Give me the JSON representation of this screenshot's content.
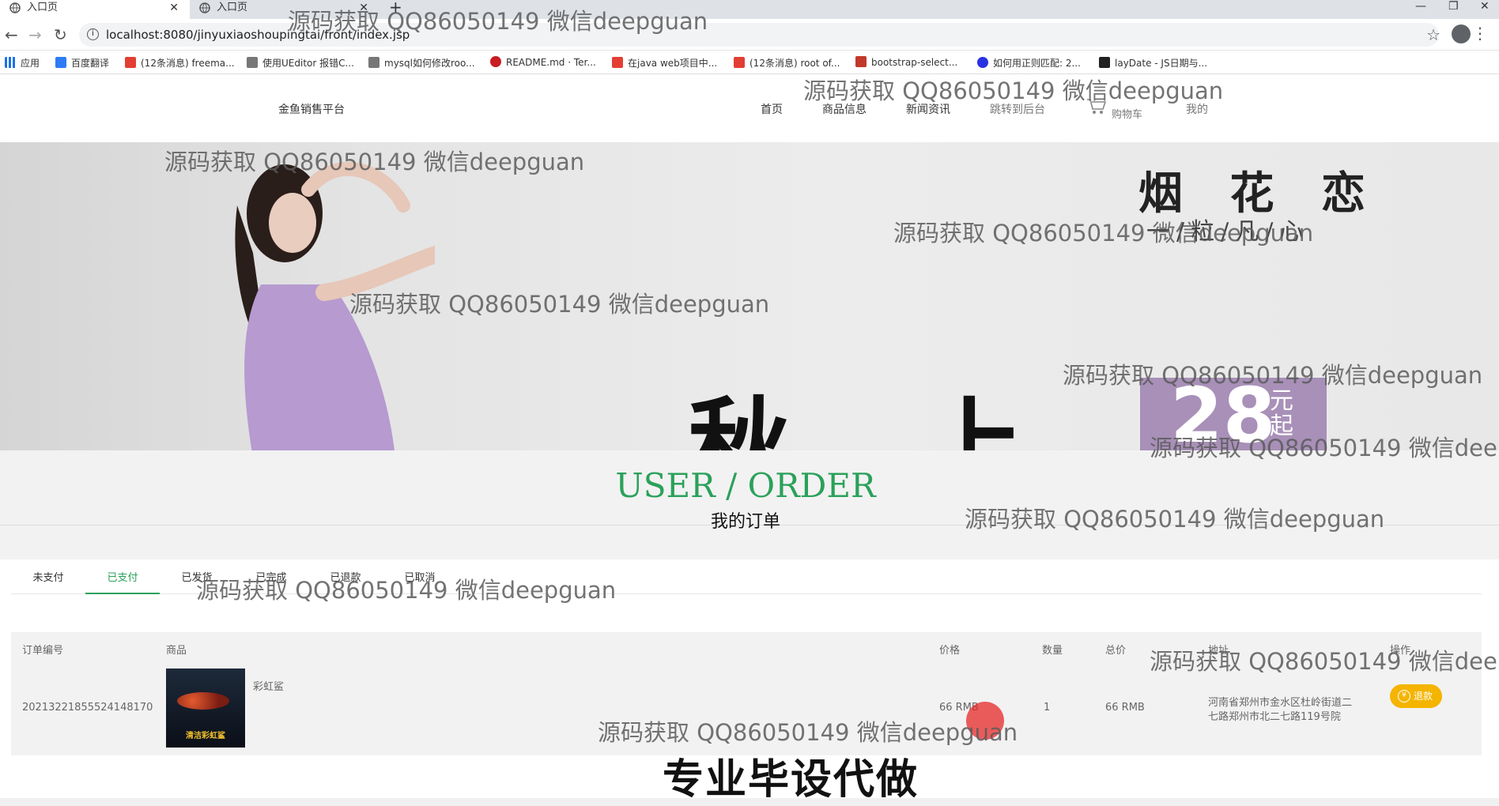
{
  "browser": {
    "tabs": [
      {
        "title": "入口页"
      },
      {
        "title": "入口页"
      }
    ],
    "new_tab": "+",
    "url": "localhost:8080/jinyuxiaoshoupingtai/front/index.jsp",
    "bookmarks": [
      {
        "label": "应用",
        "icon": "apps-grid-icon",
        "color": "#1a73e8"
      },
      {
        "label": "百度翻译",
        "icon": "baidu-translate-icon",
        "color": "#2d7cf6"
      },
      {
        "label": "(12条消息) freema...",
        "icon": "csdn-icon",
        "color": "#e33e33"
      },
      {
        "label": "使用UEditor 报错C...",
        "icon": "blog-icon",
        "color": "#444444"
      },
      {
        "label": "mysql如何修改roo...",
        "icon": "blog-icon",
        "color": "#444444"
      },
      {
        "label": "README.md · Ter...",
        "icon": "gitee-icon",
        "color": "#c71d23"
      },
      {
        "label": "在java web项目中...",
        "icon": "csdn-icon",
        "color": "#e33e33"
      },
      {
        "label": "(12条消息) root of...",
        "icon": "csdn-icon",
        "color": "#e33e33"
      },
      {
        "label": "bootstrap-select...",
        "icon": "bookmark-red-icon",
        "color": "#c0392b"
      },
      {
        "label": "如何用正则匹配: 2...",
        "icon": "baidu-paw-icon",
        "color": "#2932e1"
      },
      {
        "label": "layDate - JS日期与...",
        "icon": "layui-icon",
        "color": "#222222"
      }
    ]
  },
  "site": {
    "logo": "金鱼销售平台",
    "nav": {
      "home": "首页",
      "products": "商品信息",
      "news": "新闻资讯",
      "admin": "跳转到后台",
      "cart": "购物车",
      "mine": "我的"
    }
  },
  "banner": {
    "headline": "秋 上 新",
    "price": "28",
    "price_unit": "元起",
    "script": "烟 花 恋",
    "subtitle": "一/粒/凡/心"
  },
  "section": {
    "title_en": "USER / ORDER",
    "title_zh": "我的订单"
  },
  "order_tabs": [
    "未支付",
    "已支付",
    "已发货",
    "已完成",
    "已退款",
    "已取消"
  ],
  "active_tab": "已支付",
  "table": {
    "headers": {
      "order_no": "订单编号",
      "product": "商品",
      "price": "价格",
      "qty": "数量",
      "total": "总价",
      "address": "地址",
      "action": "操作"
    },
    "rows": [
      {
        "order_no": "20213221855524148170",
        "product": "彩虹鲨",
        "thumb_caption": "清洁彩虹鲨",
        "price": "66 RMB",
        "qty": "1",
        "total": "66 RMB",
        "address_line1": "河南省郑州市金水区杜岭街道二",
        "address_line2": "七路郑州市北二七路119号院",
        "action": "退款"
      }
    ]
  },
  "watermark": "源码获取 QQ86050149 微信deepguan",
  "caption": "专业毕设代做",
  "colors": {
    "accent": "#2aa15a",
    "refund": "#f4b400"
  }
}
